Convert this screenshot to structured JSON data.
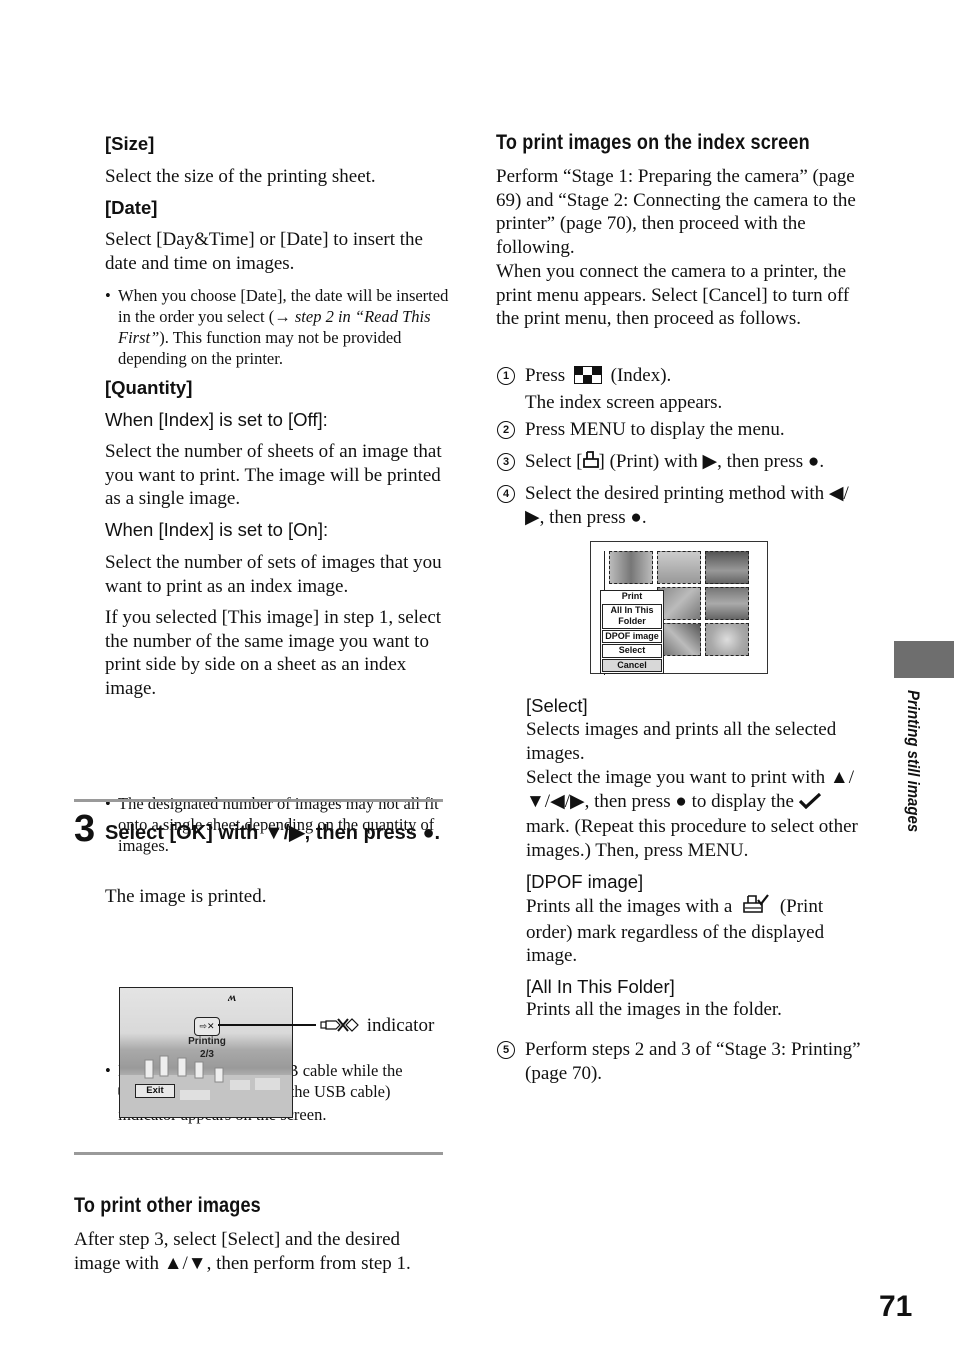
{
  "left_column": {
    "size": {
      "heading": "[Size]",
      "text": "Select the size of the printing sheet."
    },
    "date": {
      "heading": "[Date]",
      "text": "Select [Day&Time] or [Date] to insert the date and time on images.",
      "note_part1": "When you choose [Date], the date will be inserted in the order you select (",
      "note_arrow": "→",
      "note_italic": " step 2 in “Read This First”",
      "note_part2": "). This function may not be provided depending on the printer."
    },
    "quantity": {
      "heading": "[Quantity]",
      "index_off_label": "When [Index] is set to [Off]:",
      "index_off_text": "Select the number of sheets of an image that you want to print. The image will be printed as a single image.",
      "index_on_label": "When [Index] is set to [On]:",
      "index_on_text": "Select the number of sets of images that you want to print as an index image.",
      "this_image_text": "If you selected [This image] in step 1, select the number of the same image you want to print side by side on a sheet as an index image.",
      "note": "The designated number of images may not all fit onto a single sheet depending on the quantity of images."
    },
    "step3": {
      "number": "3",
      "title": "Select [OK] with ▼/▶, then press ●.",
      "text": "The image is printed.",
      "note_part1": "Do not disconnect the USB cable while the",
      "note_part2": "(Do not disconnect the USB cable) indicator appears on the screen.",
      "usb_icon": "usb-disconnect-icon",
      "callout_label": "indicator"
    },
    "printing_screen": {
      "status": "Printing",
      "progress": "2/3",
      "exit_label": "Exit",
      "battery_icon": "battery-icon"
    },
    "other_images": {
      "title": "To print other images",
      "text": "After step 3, select [Select] and the desired image with ▲/▼, then perform from step 1."
    }
  },
  "right_column": {
    "title": "To print images on the index screen",
    "intro": "Perform “Stage 1: Preparing the camera” (page 69) and “Stage 2: Connecting the camera to the printer” (page 70), then proceed with the following.",
    "intro2": "When you connect the camera to a printer, the print menu appears. Select [Cancel] to turn off the print menu, then proceed as follows.",
    "steps": [
      {
        "num": "1",
        "text_a": "Press",
        "icon": "index-icon",
        "text_b": "(Index).",
        "text_c": "The index screen appears."
      },
      {
        "num": "2",
        "text": "Press MENU to display the menu."
      },
      {
        "num": "3",
        "text_a": "Select [",
        "icon": "print-icon",
        "text_b": "] (Print) with ▶, then press ●."
      },
      {
        "num": "4",
        "text": "Select the desired printing method with ◀/▶, then press ●."
      },
      {
        "num": "5",
        "text": "Perform steps 2 and 3 of “Stage 3: Printing” (page 70)."
      }
    ],
    "print_menu": {
      "items": [
        "Print",
        "All In This Folder",
        "DPOF image",
        "Select",
        "Cancel"
      ],
      "selected": "Cancel"
    },
    "options": {
      "select": {
        "heading": "[Select]",
        "text1": "Selects images and prints all the selected images.",
        "text2": "Select the image you want to print with ▲/▼/◀/▶, then press ● to display the",
        "text3": "mark. (Repeat this procedure to select other images.) Then, press MENU.",
        "check_icon": "checkmark-icon"
      },
      "dpof": {
        "heading": "[DPOF image]",
        "text1": "Prints all the images with a",
        "text2": "(Print order) mark regardless of the displayed image.",
        "icon": "print-order-icon"
      },
      "all_in_folder": {
        "heading": "[All In This Folder]",
        "text": "Prints all the images in the folder."
      }
    }
  },
  "side_tab": {
    "label": "Printing still images"
  },
  "page_number": "71"
}
